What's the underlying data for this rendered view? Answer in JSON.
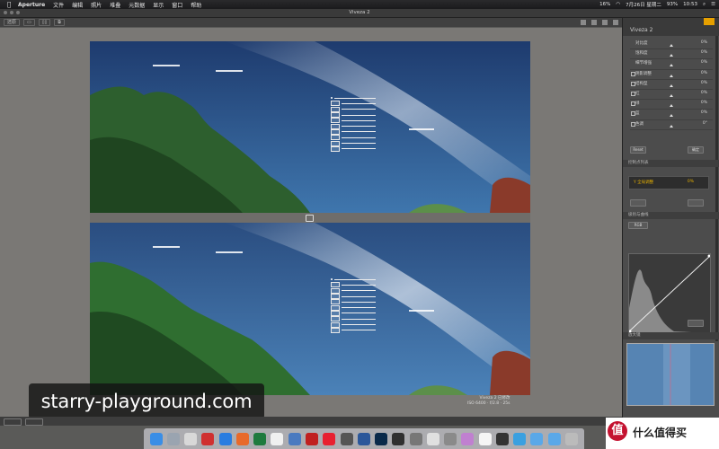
{
  "menubar": {
    "app": "Aperture",
    "items": [
      "文件",
      "编辑",
      "照片",
      "堆叠",
      "元数据",
      "显示",
      "窗口",
      "帮助"
    ],
    "status_left": "16%",
    "time": "10:53",
    "date": "7月26日 星期二",
    "battery": "93%"
  },
  "window": {
    "title": "Viveza 2"
  },
  "toolbar": {
    "left_label": "还原"
  },
  "panel": {
    "title": "Viveza 2",
    "sliders": [
      {
        "label": "对比度",
        "value": "0%"
      },
      {
        "label": "饱和度",
        "value": "0%"
      },
      {
        "label": "细节增强",
        "value": "0%"
      },
      {
        "label": "阴影调整",
        "value": "0%"
      },
      {
        "label": "结构型",
        "value": "0%"
      },
      {
        "label": "红",
        "value": "0%"
      },
      {
        "label": "绿",
        "value": "0%"
      },
      {
        "label": "蓝",
        "value": "0%"
      },
      {
        "label": "色调",
        "value": "0°"
      }
    ],
    "reset_button": "Reset",
    "ok_button": "确定",
    "section1": "控制点列表",
    "filter_name": "Y 全局调整",
    "filter_value": "0%",
    "section2": "级别与曲线",
    "channel": "RGB",
    "section3": "放大镜"
  },
  "caption": {
    "line1": "Viveza 2 已修改",
    "line2": "ISO 6400 · f/2.8 · 25s"
  },
  "watermark": "starry-playground.com",
  "logo": {
    "glyph": "值",
    "text": "什么值得买"
  },
  "colors": {
    "accent": "#e8b100",
    "sky": "#3d6a9c",
    "tree": "#2e6a2e",
    "panel": "#4c4c4c"
  },
  "dock_icons": [
    "finder",
    "safari",
    "launchpad",
    "mail",
    "maps",
    "photos",
    "excel",
    "calendar",
    "notes",
    "messages",
    "music",
    "appstore",
    "word",
    "ps",
    "aperture",
    "preferences",
    "chrome",
    "photos2",
    "itunes",
    "preview",
    "terminal",
    "maps2",
    "folder",
    "folder2",
    "trash"
  ]
}
